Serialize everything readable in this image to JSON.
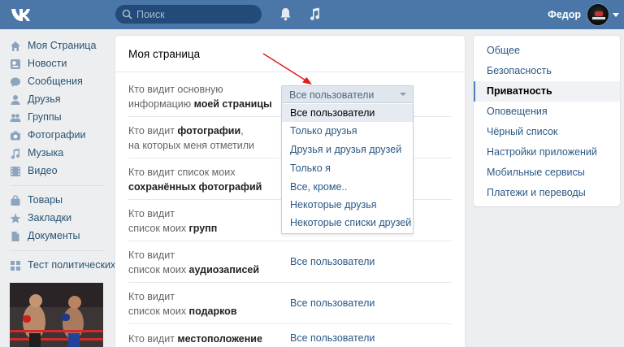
{
  "header": {
    "logo": "vk-logo-icon",
    "search_placeholder": "Поиск",
    "user_name": "Федор"
  },
  "sidebar": {
    "items": [
      {
        "label": "Моя Страница",
        "icon": "home-icon"
      },
      {
        "label": "Новости",
        "icon": "news-icon"
      },
      {
        "label": "Сообщения",
        "icon": "messages-icon"
      },
      {
        "label": "Друзья",
        "icon": "friends-icon"
      },
      {
        "label": "Группы",
        "icon": "groups-icon"
      },
      {
        "label": "Фотографии",
        "icon": "camera-icon"
      },
      {
        "label": "Музыка",
        "icon": "music-icon"
      },
      {
        "label": "Видео",
        "icon": "video-icon"
      },
      {
        "label": "Товары",
        "icon": "bag-icon"
      },
      {
        "label": "Закладки",
        "icon": "star-icon"
      },
      {
        "label": "Документы",
        "icon": "document-icon"
      },
      {
        "label": "Тест политических",
        "icon": "apps-icon"
      }
    ]
  },
  "main": {
    "title": "Моя страница",
    "rows": [
      {
        "q1": "Кто видит основную",
        "q2a": "информацию ",
        "q2b": "моей страницы",
        "value": ""
      },
      {
        "q1": "Кто видит ",
        "q1b": "фотографии",
        "q1c": ",",
        "q2": "на которых меня отметили",
        "value": ""
      },
      {
        "q1": "Кто видит список моих",
        "q2b": "сохранённых фотографий",
        "value": ""
      },
      {
        "q1": "Кто видит",
        "q2a": "список моих ",
        "q2b": "групп",
        "value": ""
      },
      {
        "q1": "Кто видит",
        "q2a": "список моих ",
        "q2b": "аудиозаписей",
        "value": "Все пользователи"
      },
      {
        "q1": "Кто видит",
        "q2a": "список моих ",
        "q2b": "подарков",
        "value": "Все пользователи"
      },
      {
        "q1a": "Кто видит ",
        "q1b": "местоположение",
        "value": "Все пользователи"
      }
    ]
  },
  "dropdown": {
    "selected": "Все пользователи",
    "options": [
      "Все пользователи",
      "Только друзья",
      "Друзья и друзья друзей",
      "Только я",
      "Все, кроме..",
      "Некоторые друзья",
      "Некоторые списки друзей"
    ],
    "active_index": 0
  },
  "right_nav": {
    "items": [
      "Общее",
      "Безопасность",
      "Приватность",
      "Оповещения",
      "Чёрный список",
      "Настройки приложений",
      "Мобильные сервисы",
      "Платежи и переводы"
    ],
    "active_index": 2
  },
  "colors": {
    "header": "#4a76a8",
    "link": "#2a5885",
    "annotation_arrow": "#e02020"
  }
}
